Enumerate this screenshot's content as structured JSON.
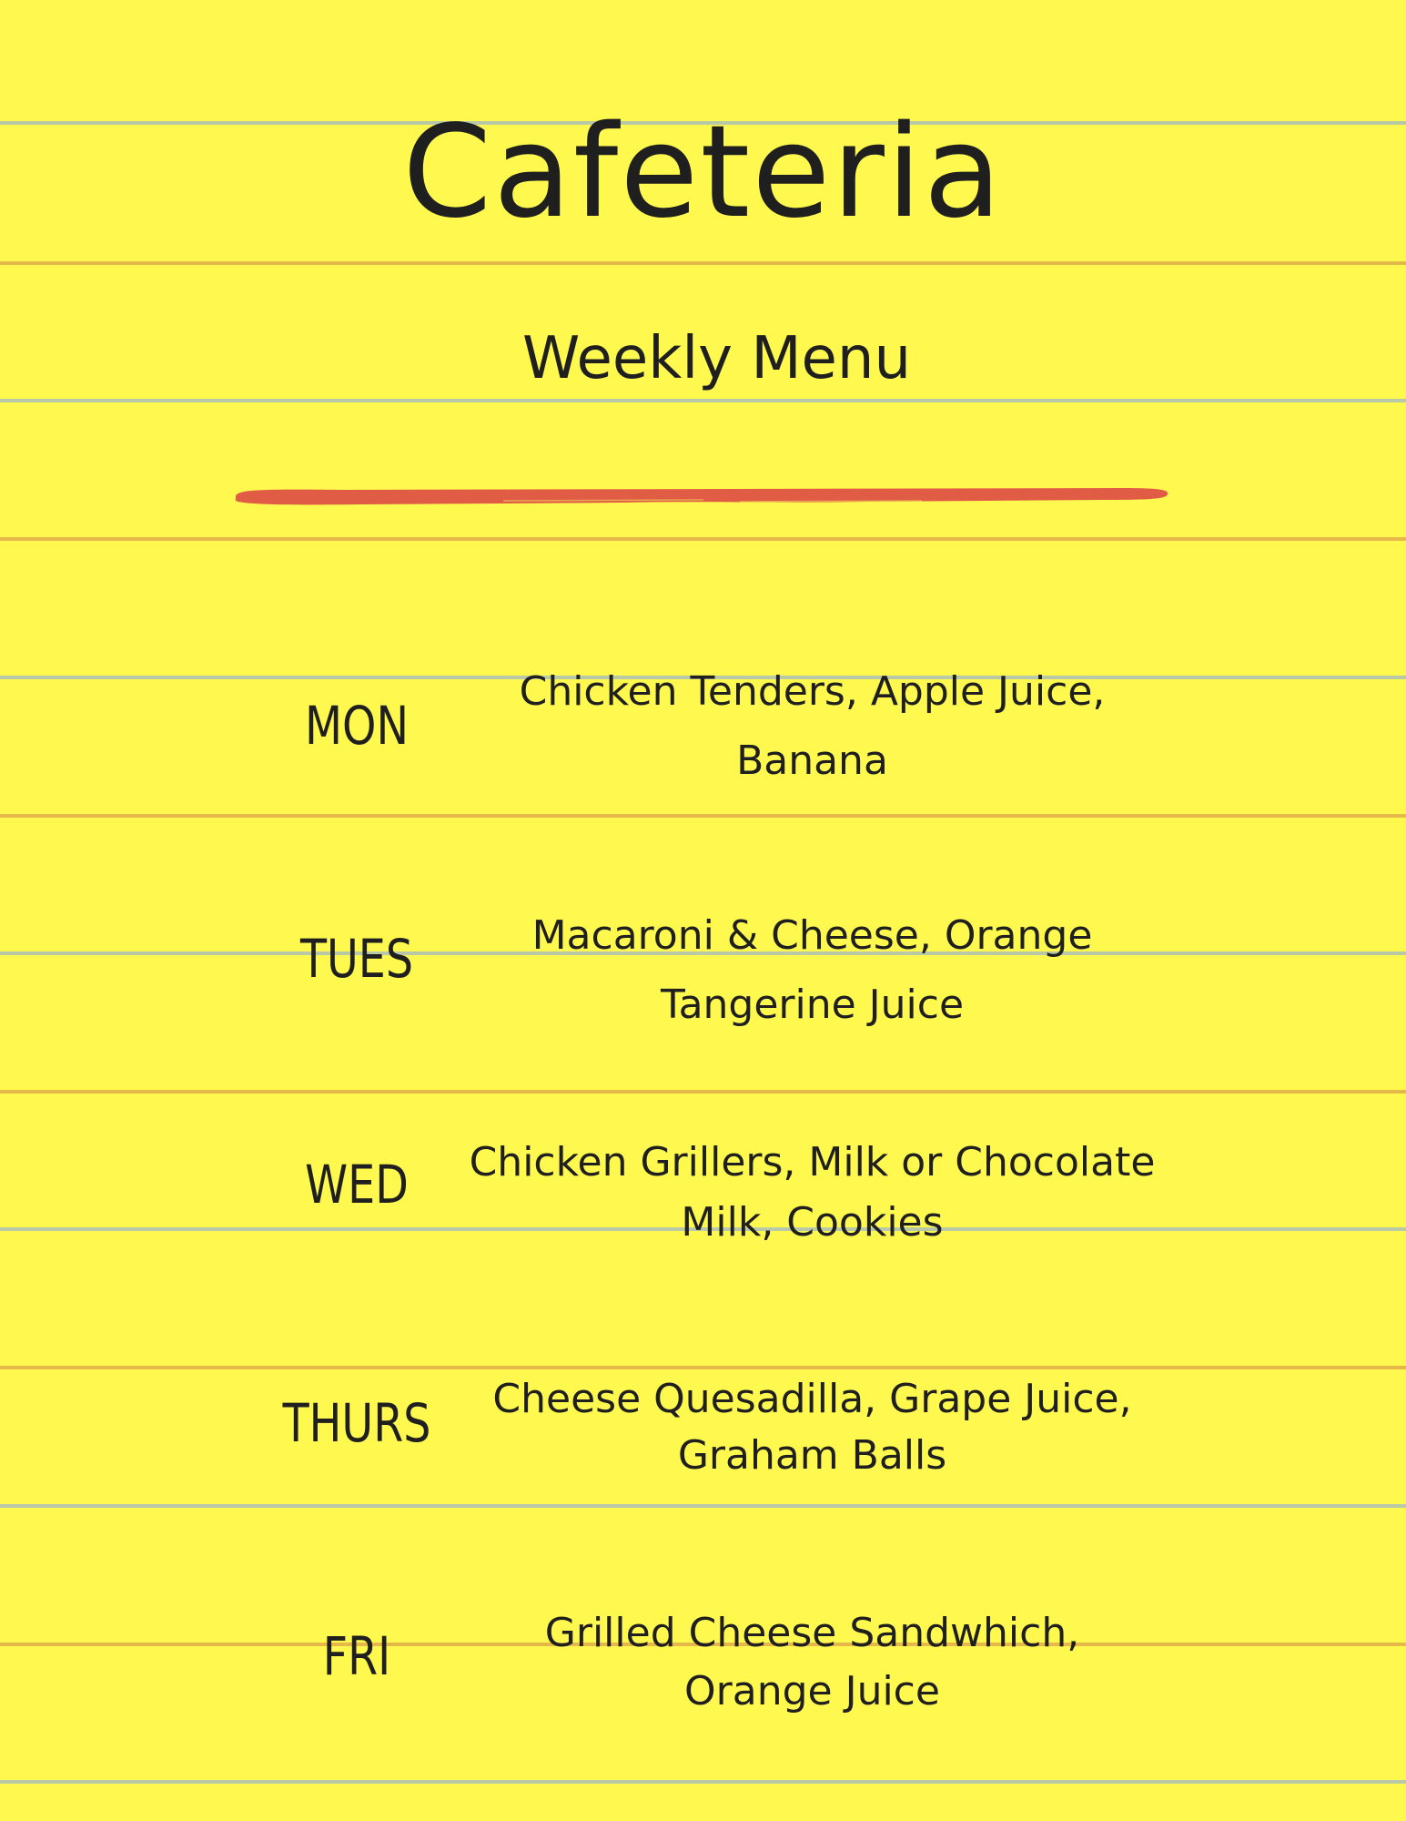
{
  "title": "Cafeteria",
  "subtitle": "Weekly Menu",
  "colors": {
    "paper": "#fef84f",
    "ruled_line_blue": "#b9c9a8",
    "ruled_line_orange": "#e6b84a",
    "brush_stroke": "#e05c45",
    "ink": "#1f1f1f"
  },
  "menu": [
    {
      "day": "MON",
      "items": "Chicken Tenders, Apple Juice,\nBanana"
    },
    {
      "day": "TUES",
      "items": "Macaroni & Cheese, Orange\nTangerine Juice"
    },
    {
      "day": "WED",
      "items": "Chicken Grillers, Milk or Chocolate\nMilk, Cookies"
    },
    {
      "day": "THURS",
      "items": "Cheese Quesadilla, Grape Juice,\nGraham Balls"
    },
    {
      "day": "FRI",
      "items": "Grilled Cheese Sandwhich,\nOrange Juice"
    }
  ]
}
